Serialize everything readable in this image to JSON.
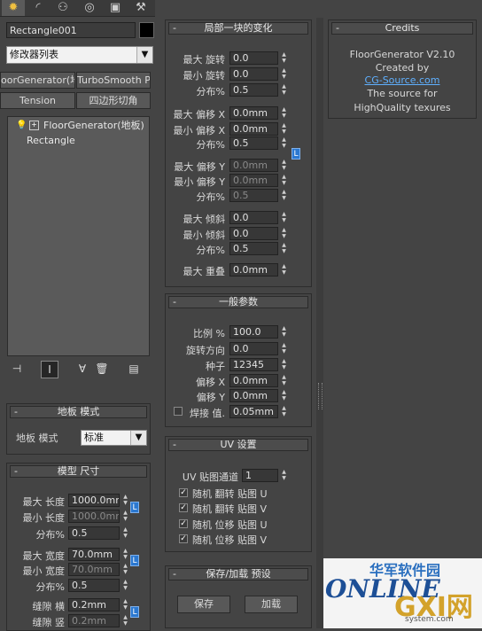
{
  "colors": {
    "lock": "#2b78d0",
    "panel": "#444444",
    "field": "#373737",
    "credits_link": "#5fb0ff"
  },
  "tabs": [
    {
      "name": "create-tab-icon",
      "glyph": "✹"
    },
    {
      "name": "modify-tab-icon",
      "glyph": "◜"
    },
    {
      "name": "hierarchy-tab-icon",
      "glyph": "⚇"
    },
    {
      "name": "motion-tab-icon",
      "glyph": "◎"
    },
    {
      "name": "display-tab-icon",
      "glyph": "▣"
    },
    {
      "name": "utilities-tab-icon",
      "glyph": "⚒"
    }
  ],
  "object_name": "Rectangle001",
  "modifier_list": "修改器列表",
  "mod_buttons": {
    "b1": "oorGenerator(地转",
    "b2": "TurboSmooth Pro",
    "b3": "Tension",
    "b4": "四边形切角"
  },
  "stack": {
    "item1": "FloorGenerator(地板)",
    "item2": "Rectangle"
  },
  "floor_mode": {
    "title": "地板 模式",
    "label": "地板 模式",
    "value": "标准"
  },
  "model_size": {
    "title": "模型 尺寸",
    "max_length": {
      "label": "最大 长度",
      "value": "1000.0mm"
    },
    "min_length": {
      "label": "最小 长度",
      "value": "1000.0mm"
    },
    "dist1": {
      "label": "分布%",
      "value": "0.5"
    },
    "max_width": {
      "label": "最大 宽度",
      "value": "70.0mm"
    },
    "min_width": {
      "label": "最小 宽度",
      "value": "70.0mm"
    },
    "dist2": {
      "label": "分布%",
      "value": "0.5"
    },
    "gap_h": {
      "label": "缝隙 横",
      "value": "0.2mm"
    },
    "gap_v": {
      "label": "缝隙 竖",
      "value": "0.2mm"
    }
  },
  "local": {
    "title": "局部一块的变化",
    "max_rot": {
      "label": "最大 旋转",
      "value": "0.0"
    },
    "min_rot": {
      "label": "最小 旋转",
      "value": "0.0"
    },
    "rot_dist": {
      "label": "分布%",
      "value": "0.5"
    },
    "max_offx": {
      "label": "最大 偏移 X",
      "value": "0.0mm"
    },
    "min_offx": {
      "label": "最小 偏移 X",
      "value": "0.0mm"
    },
    "offx_dist": {
      "label": "分布%",
      "value": "0.5"
    },
    "max_offy": {
      "label": "最大 偏移 Y",
      "value": "0.0mm"
    },
    "min_offy": {
      "label": "最小 偏移 Y",
      "value": "0.0mm"
    },
    "offy_dist": {
      "label": "分布%",
      "value": "0.5"
    },
    "max_tilt": {
      "label": "最大 倾斜",
      "value": "0.0"
    },
    "min_tilt": {
      "label": "最小 倾斜",
      "value": "0.0"
    },
    "tilt_dist": {
      "label": "分布%",
      "value": "0.5"
    },
    "max_overlap": {
      "label": "最大 重叠",
      "value": "0.0mm"
    }
  },
  "general": {
    "title": "一般参数",
    "scale": {
      "label": "比例 %",
      "value": "100.0"
    },
    "rotdir": {
      "label": "旋转方向",
      "value": "0.0"
    },
    "seed": {
      "label": "种子",
      "value": "12345"
    },
    "offx": {
      "label": "偏移 X",
      "value": "0.0mm"
    },
    "offy": {
      "label": "偏移 Y",
      "value": "0.0mm"
    },
    "weld": {
      "label": "焊接 值.",
      "value": "0.05mm"
    }
  },
  "uv": {
    "title": "UV 设置",
    "channel": {
      "label": "UV 贴图通道",
      "value": "1"
    },
    "c1": "随机 翻转 贴图 U",
    "c2": "随机 翻转 贴图 V",
    "c3": "随机 位移 贴图 U",
    "c4": "随机 位移 贴图 V"
  },
  "preset": {
    "title": "保存/加载 预设",
    "save": "保存",
    "load": "加载"
  },
  "credits": {
    "title": "Credits",
    "l1": "FloorGenerator V2.10",
    "l2": "Created by",
    "l3": "CG-Source.com",
    "l4": "The source for",
    "l5": "HighQuality texures"
  },
  "watermark": {
    "top": "华军软件园",
    "brand": "ONLINE",
    "site": "GXI网",
    "sub": "system.com"
  }
}
